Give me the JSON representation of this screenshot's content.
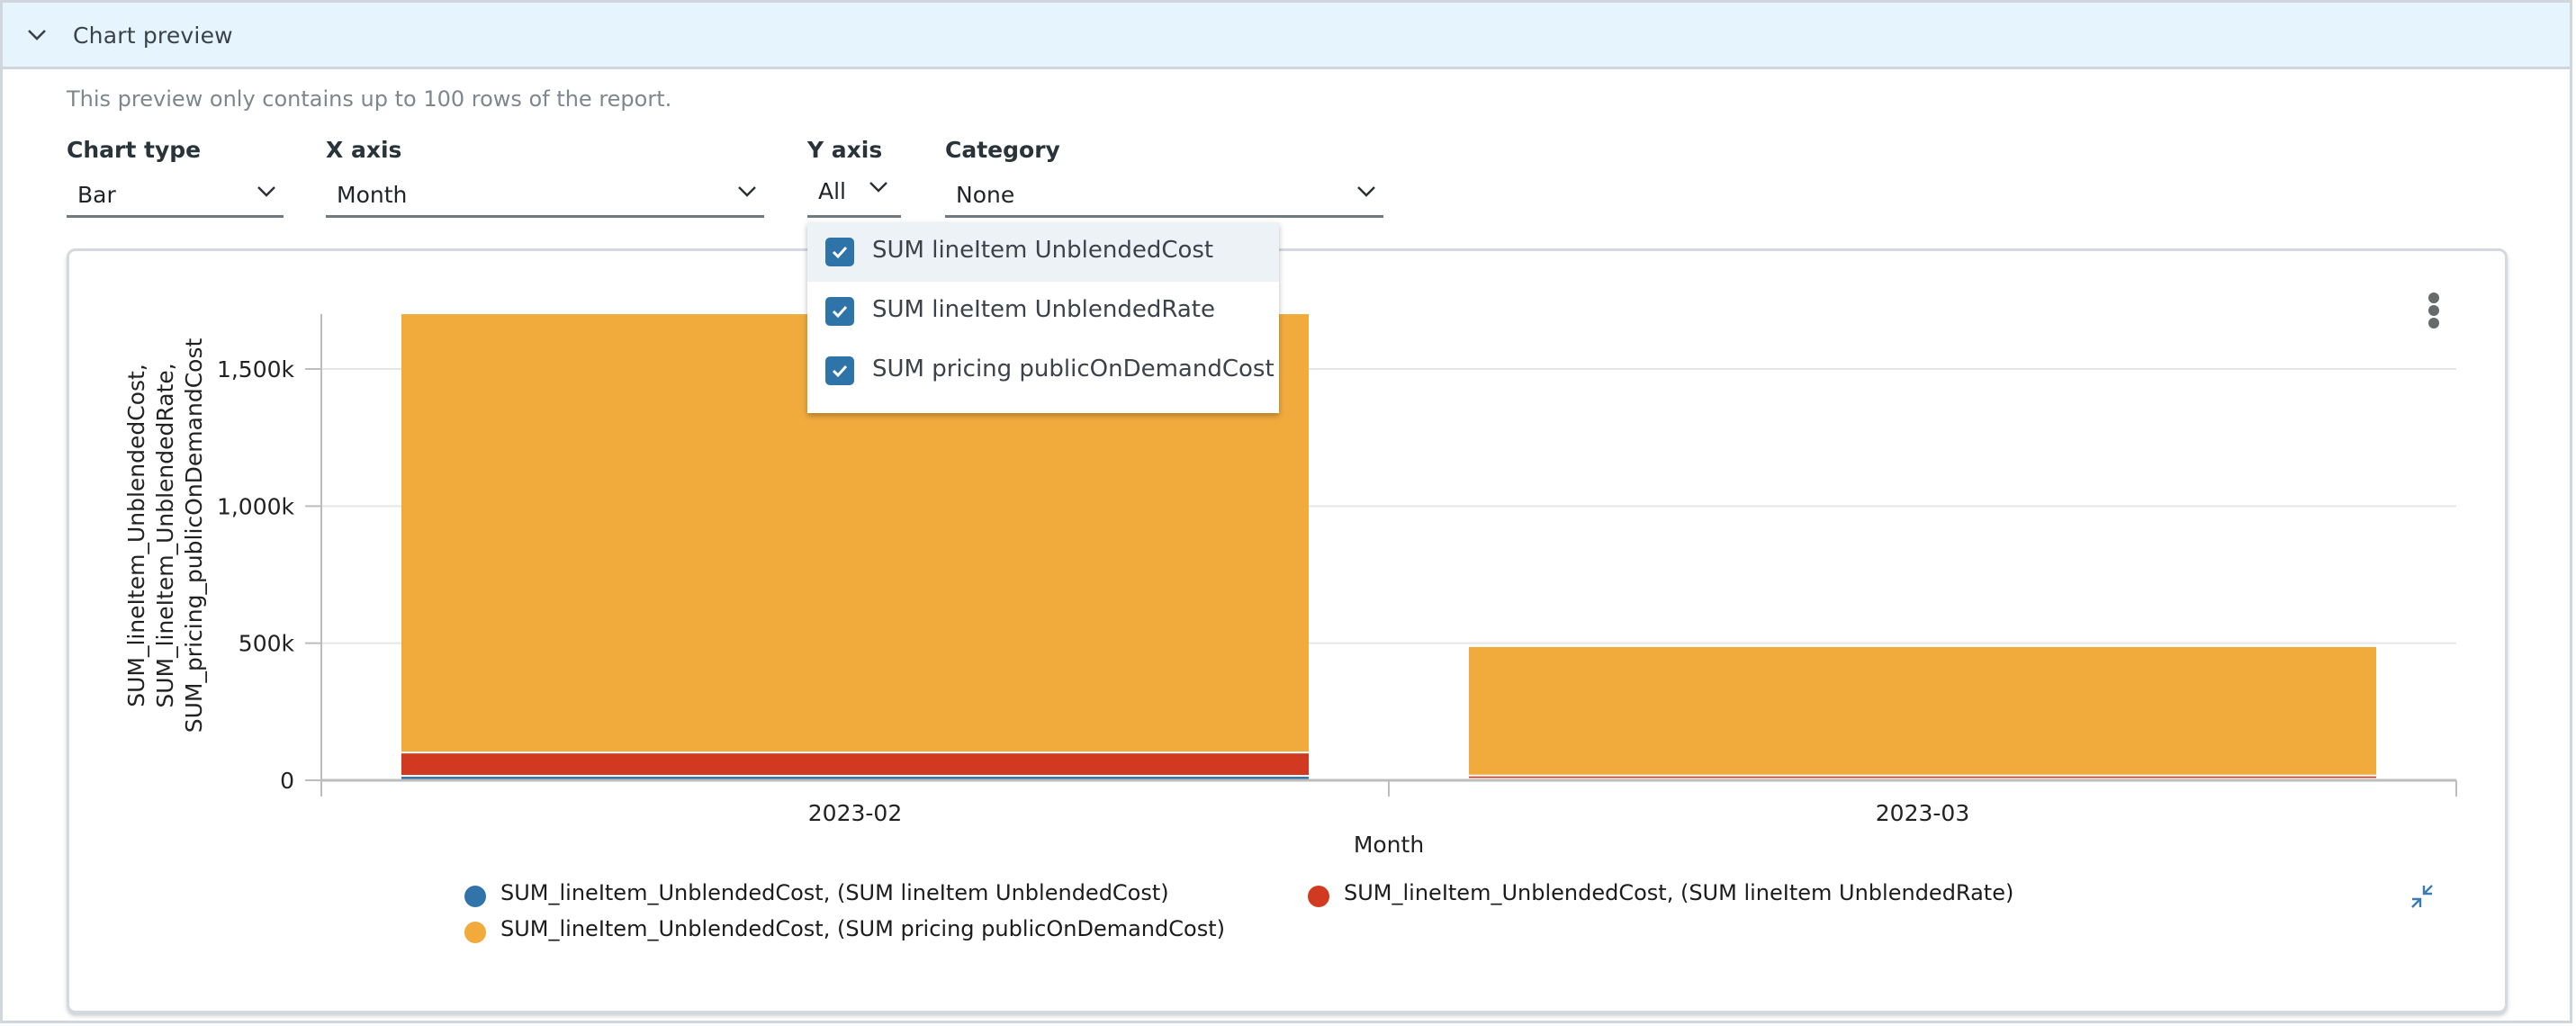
{
  "header": {
    "title": "Chart preview",
    "expanded": true,
    "icon": "chevron-down-icon"
  },
  "notice": "This preview only contains up to 100 rows of the report.",
  "controls": {
    "chart_type": {
      "label": "Chart type",
      "value": "Bar"
    },
    "x_axis": {
      "label": "X axis",
      "value": "Month"
    },
    "y_axis": {
      "label": "Y axis",
      "value": "All"
    },
    "category": {
      "label": "Category",
      "value": "None"
    }
  },
  "y_axis_dropdown": {
    "open": true,
    "options": [
      {
        "label": "SUM lineItem UnblendedCost",
        "checked": true,
        "hovered": true
      },
      {
        "label": "SUM lineItem UnblendedRate",
        "checked": true,
        "hovered": false
      },
      {
        "label": "SUM pricing publicOnDemandCost",
        "checked": true,
        "hovered": false
      }
    ]
  },
  "card": {
    "menu_icon": "kebab-menu-icon",
    "collapse_icon": "collapse-icon"
  },
  "colors": {
    "blue": "#3274a9",
    "red": "#d13a21",
    "orange": "#f1aa3c",
    "header_bg": "#e6f5fd",
    "checkbox": "#2e74a8"
  },
  "chart_data": {
    "type": "bar",
    "stacked": true,
    "title": "",
    "xlabel": "Month",
    "ylabel_lines": [
      "SUM_lineItem_UnblendedCost,",
      "SUM_lineItem_UnblendedRate,",
      "SUM_pricing_publicOnDemandCost"
    ],
    "categories": [
      "2023-02",
      "2023-03"
    ],
    "ylim": [
      0,
      1750000
    ],
    "yticks": [
      0,
      500000,
      1000000,
      1500000
    ],
    "ytick_labels": [
      "0",
      "500k",
      "1,000k",
      "1,500k"
    ],
    "grid": true,
    "legend_position": "bottom",
    "series": [
      {
        "name": "SUM_lineItem_UnblendedCost, (SUM lineItem UnblendedCost)",
        "color": "#3274a9",
        "values": [
          13000,
          2000
        ]
      },
      {
        "name": "SUM_lineItem_UnblendedCost, (SUM lineItem UnblendedRate)",
        "color": "#d13a21",
        "values": [
          85000,
          12000
        ]
      },
      {
        "name": "SUM_lineItem_UnblendedCost, (SUM pricing publicOnDemandCost)",
        "color": "#f1aa3c",
        "values": [
          1602000,
          472000
        ]
      }
    ]
  }
}
